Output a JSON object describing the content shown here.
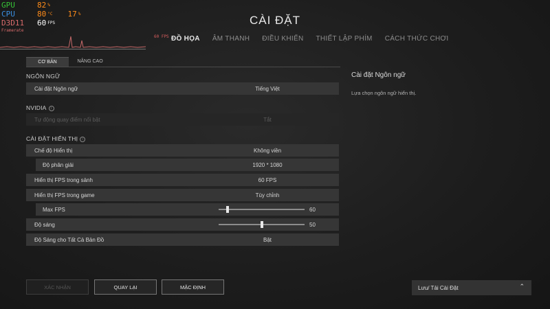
{
  "overlay": {
    "gpu_label": "GPU",
    "gpu_value": "82",
    "gpu_unit": "%",
    "cpu_label": "CPU",
    "cpu_value": "80",
    "cpu_unit": "°C",
    "cpu_value2": "17",
    "cpu_unit2": "%",
    "api_label": "D3D11",
    "fps_value": "60",
    "fps_unit": "FPS",
    "framerate_label": "Framerate",
    "mini_fps": "60 FPS",
    "colors": {
      "gpu": "#36c236",
      "cpu": "#3a8ee0",
      "d3d": "#d96b6b",
      "value": "#ff8c1a",
      "fps": "#ffffff"
    }
  },
  "page_title": "CÀI ĐẶT",
  "top_tabs": [
    {
      "label": "ĐỒ HỌA",
      "active": true
    },
    {
      "label": "ÂM THANH",
      "active": false
    },
    {
      "label": "ĐIỀU KHIỂN",
      "active": false
    },
    {
      "label": "THIẾT LẬP PHÍM",
      "active": false
    },
    {
      "label": "CÁCH THỨC CHƠI",
      "active": false
    }
  ],
  "sub_tabs": [
    {
      "label": "CƠ BẢN",
      "active": true
    },
    {
      "label": "NÂNG CAO",
      "active": false
    }
  ],
  "sections": {
    "language": "NGÔN NGỮ",
    "nvidia": "NVIDIA",
    "display": "CÀI ĐẶT HIỂN THỊ"
  },
  "rows": {
    "language": {
      "label": "Cài đặt Ngôn ngữ",
      "value": "Tiếng Việt"
    },
    "highlights": {
      "label": "Tự động quay điểm nổi bật",
      "value": "Tắt"
    },
    "display_mode": {
      "label": "Chế độ Hiển thị",
      "value": "Không viền"
    },
    "resolution": {
      "label": "Độ phân giải",
      "value": "1920 * 1080"
    },
    "fps_lobby": {
      "label": "Hiển thị FPS trong sảnh",
      "value": "60 FPS"
    },
    "fps_game": {
      "label": "Hiển thị FPS trong game",
      "value": "Tùy chỉnh"
    },
    "max_fps": {
      "label": "Max FPS",
      "value": "60",
      "level": 0.1
    },
    "brightness": {
      "label": "Độ sáng",
      "value": "50",
      "level": 0.5
    },
    "all_maps_brightness": {
      "label": "Độ Sáng cho Tất Cả Bản Đồ",
      "value": "Bật"
    }
  },
  "detail_panel": {
    "title": "Cài đặt Ngôn ngữ",
    "description": "Lựa chọn ngôn ngữ hiển thị."
  },
  "buttons": {
    "confirm": "XÁC NHẬN",
    "back": "QUAY LẠI",
    "default": "MẶC ĐỊNH"
  },
  "save_load": {
    "label": "Lưu/ Tải Cài Đặt",
    "icon": "chevron-up-icon"
  }
}
